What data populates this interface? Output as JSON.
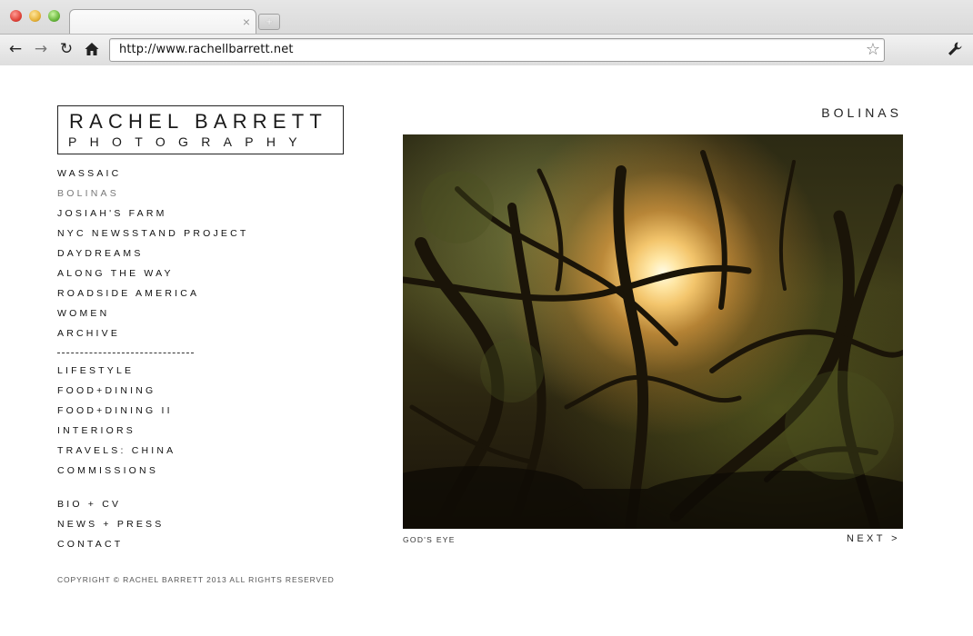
{
  "browser": {
    "url": "http://www.rachellbarrett.net",
    "tab_close": "×",
    "new_tab": "+",
    "icons": {
      "back": "back-arrow-icon",
      "forward": "forward-arrow-icon",
      "reload": "reload-icon",
      "home": "home-icon",
      "bookmark": "star-icon",
      "settings": "wrench-icon"
    }
  },
  "site": {
    "logo_line1": "RACHEL BARRETT",
    "logo_line2": "PHOTOGRAPHY",
    "nav": {
      "galleries": [
        {
          "label": "WASSAIC",
          "active": false
        },
        {
          "label": "BOLINAS",
          "active": true
        },
        {
          "label": "JOSIAH'S FARM",
          "active": false
        },
        {
          "label": "NYC NEWSSTAND PROJECT",
          "active": false
        },
        {
          "label": "DAYDREAMS",
          "active": false
        },
        {
          "label": "ALONG THE WAY",
          "active": false
        },
        {
          "label": "ROADSIDE AMERICA",
          "active": false
        },
        {
          "label": "WOMEN",
          "active": false
        },
        {
          "label": "ARCHIVE",
          "active": false
        }
      ],
      "commercial": [
        {
          "label": "LIFESTYLE"
        },
        {
          "label": "FOOD+DINING"
        },
        {
          "label": "FOOD+DINING II"
        },
        {
          "label": "INTERIORS"
        },
        {
          "label": "TRAVELS: CHINA"
        },
        {
          "label": "COMMISSIONS"
        }
      ],
      "info": [
        {
          "label": "BIO + CV"
        },
        {
          "label": "NEWS + PRESS"
        },
        {
          "label": "CONTACT"
        }
      ]
    },
    "copyright": "COPYRIGHT © RACHEL BARRETT 2013 ALL RIGHTS RESERVED",
    "gallery_title": "BOLINAS",
    "photo_caption": "GOD'S EYE",
    "next_label": "NEXT >",
    "colors": {
      "text": "#111111",
      "active_nav": "#777777",
      "background": "#ffffff"
    }
  }
}
